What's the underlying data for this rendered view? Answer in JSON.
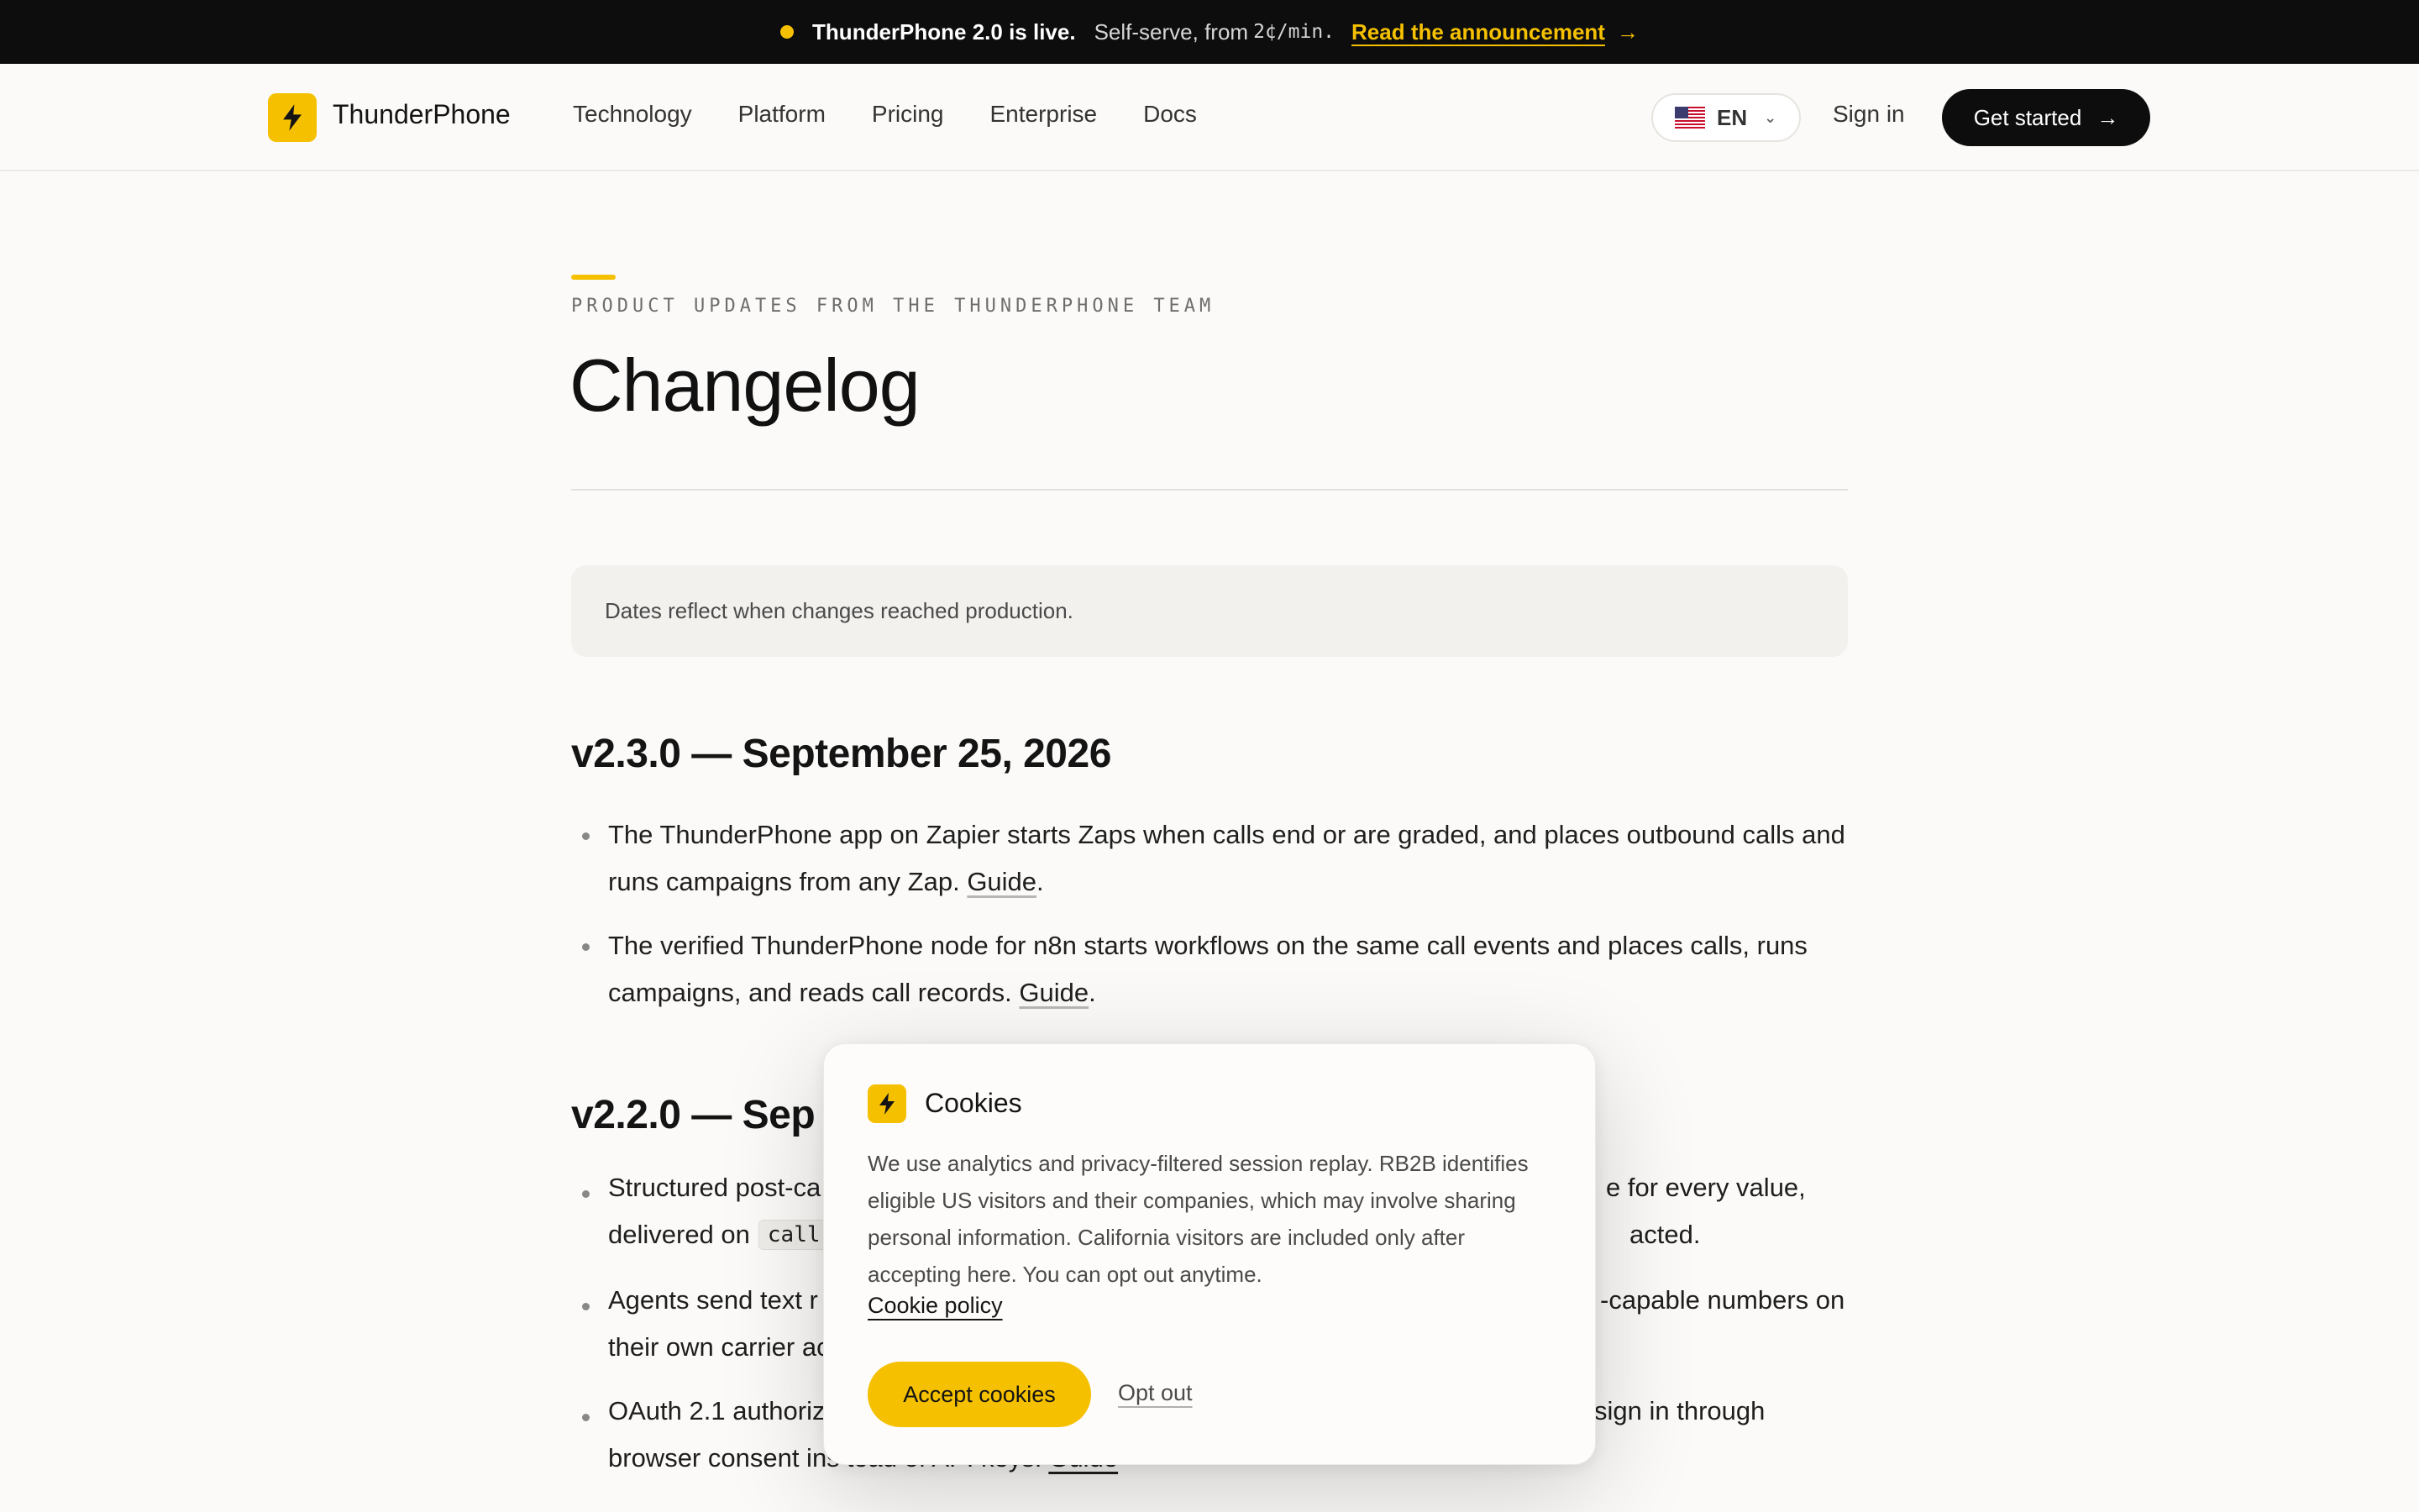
{
  "announcement": {
    "headline": "ThunderPhone 2.0 is live.",
    "subtext": "Self-serve, from",
    "price": "2¢/min.",
    "link": "Read the announcement",
    "arrow": "→"
  },
  "nav": {
    "brand": "ThunderPhone",
    "links": [
      "Technology",
      "Platform",
      "Pricing",
      "Enterprise",
      "Docs"
    ],
    "language": "EN",
    "sign_in": "Sign in",
    "cta": "Get started",
    "cta_arrow": "→"
  },
  "header": {
    "eyebrow": "PRODUCT UPDATES FROM THE THUNDERPHONE TEAM",
    "title": "Changelog"
  },
  "note": "Dates reflect when changes reached production.",
  "releases": [
    {
      "version": "v2.3.0 — September 25, 2026",
      "items": [
        {
          "text": "The ThunderPhone app on Zapier starts Zaps when calls end or are graded, and places outbound calls and runs campaigns from any Zap.",
          "link": "Guide"
        },
        {
          "text": "The verified ThunderPhone node for n8n starts workflows on the same call events and places calls, runs campaigns, and reads call records.",
          "link": "Guide"
        }
      ]
    },
    {
      "version": "v2.2.0 — Sep",
      "items": [
        {
          "a": "Structured post-ca",
          "b": "e for every value,"
        },
        {
          "a": "delivered on",
          "code": "call",
          "b": "acted."
        },
        {
          "a": "Agents send text r",
          "b": "-capable numbers on"
        },
        {
          "a": "their own carrier ac",
          "b": ""
        },
        {
          "a": "OAuth 2.1 authoriz",
          "b": "sign in through"
        },
        {
          "a": "browser consent ins",
          "b": "tead of API keys.",
          "link": "Guide"
        }
      ]
    }
  ],
  "cookie_banner": {
    "title": "Cookies",
    "body": "We use analytics and privacy-filtered session replay. RB2B identifies eligible US visitors and their companies, which may involve sharing personal information. California visitors are included only after accepting here. You can opt out anytime.",
    "policy_link": "Cookie policy",
    "accept": "Accept cookies",
    "opt_out": "Opt out"
  },
  "colors": {
    "accent": "#f5c000",
    "dark": "#0d0d0d",
    "background": "#fbfaf8"
  },
  "icons": {
    "logo": "lightning-bolt-icon",
    "flag": "us-flag-icon",
    "chevron": "chevron-down-icon",
    "arrow": "arrow-right-icon"
  }
}
